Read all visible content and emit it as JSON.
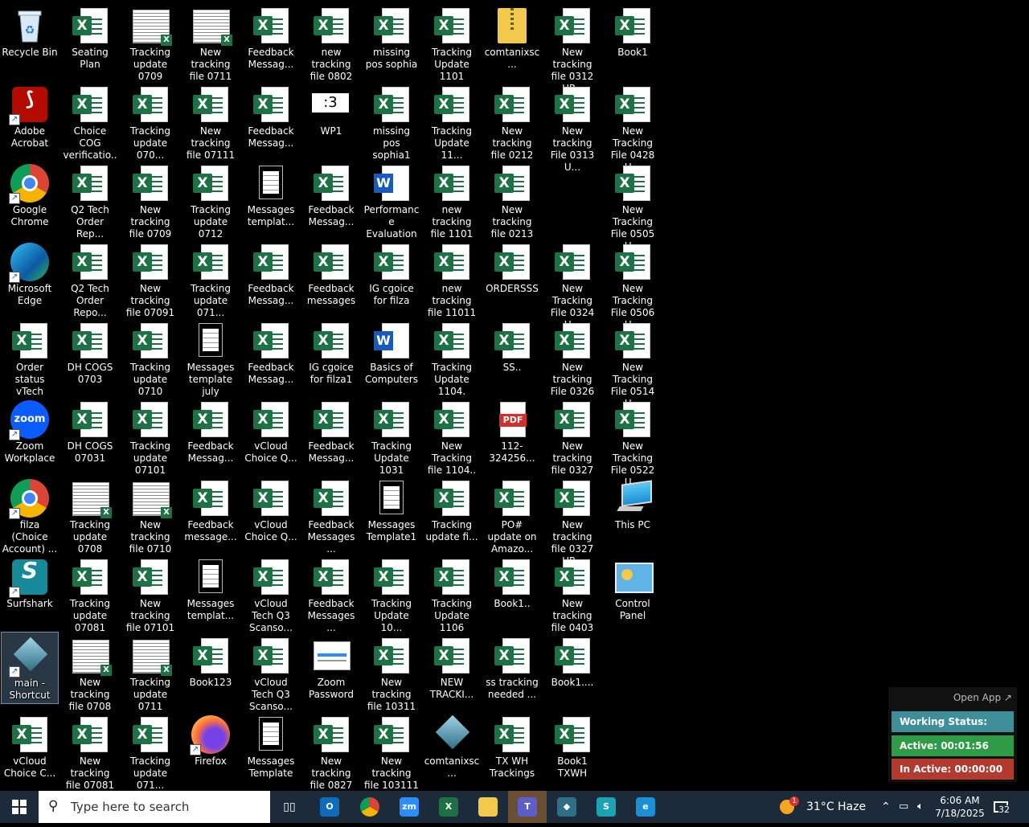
{
  "desktop_icons": [
    {
      "label": "Recycle Bin",
      "type": "recycle"
    },
    {
      "label": "Seating Plan",
      "type": "excel"
    },
    {
      "label": "Tracking update 0709",
      "type": "sheet"
    },
    {
      "label": "New tracking file 0711",
      "type": "sheet"
    },
    {
      "label": "Feedback Messag...",
      "type": "excel"
    },
    {
      "label": "new tracking file 0802",
      "type": "excel"
    },
    {
      "label": "missing pos sophia",
      "type": "excel"
    },
    {
      "label": "Tracking Update 1101",
      "type": "excel"
    },
    {
      "label": "comtanixsc...",
      "type": "zip"
    },
    {
      "label": "New tracking file 0312 UP...",
      "type": "excel"
    },
    {
      "label": "Book1",
      "type": "excel"
    },
    {
      "label": "Adobe Acrobat",
      "type": "acrobat",
      "shortcut": true
    },
    {
      "label": "Choice COG verificatio...",
      "type": "excel"
    },
    {
      "label": "Tracking update 070...",
      "type": "excel"
    },
    {
      "label": "New tracking file 07111",
      "type": "excel"
    },
    {
      "label": "Feedback Messag...",
      "type": "excel"
    },
    {
      "label": "WP1",
      "type": "wp",
      "glyph": ":3"
    },
    {
      "label": "missing pos sophia1",
      "type": "excel"
    },
    {
      "label": "Tracking Update 11...",
      "type": "excel"
    },
    {
      "label": "New tracking file 0212",
      "type": "excel"
    },
    {
      "label": "New tracking File 0313 U...",
      "type": "excel"
    },
    {
      "label": "New Tracking File 0428 U...",
      "type": "excel"
    },
    {
      "label": "Google Chrome",
      "type": "chrome",
      "shortcut": true
    },
    {
      "label": "Q2 Tech Order Rep...",
      "type": "excel"
    },
    {
      "label": "New tracking file 0709",
      "type": "excel"
    },
    {
      "label": "Tracking update 0712",
      "type": "excel"
    },
    {
      "label": "Messages templat...",
      "type": "doc"
    },
    {
      "label": "Feedback Messag...",
      "type": "excel"
    },
    {
      "label": "Performance Evaluation ...",
      "type": "word"
    },
    {
      "label": "new tracking file 1101",
      "type": "excel"
    },
    {
      "label": "New tracking file 0213",
      "type": "excel"
    },
    {
      "label": "New Tracking File 0505 U...",
      "type": "excel"
    },
    {
      "label": "Microsoft Edge",
      "type": "edge",
      "shortcut": true
    },
    {
      "label": "Q2 Tech Order Repo...",
      "type": "excel"
    },
    {
      "label": "New tracking file 07091",
      "type": "excel"
    },
    {
      "label": "Tracking update 071...",
      "type": "excel"
    },
    {
      "label": "Feedback Messag...",
      "type": "excel"
    },
    {
      "label": "Feedback messages",
      "type": "excel"
    },
    {
      "label": "IG cgoice for filza",
      "type": "excel"
    },
    {
      "label": "new tracking file 11011",
      "type": "excel"
    },
    {
      "label": "ORDERSSS",
      "type": "excel"
    },
    {
      "label": "New Tracking File 0324 U...",
      "type": "excel"
    },
    {
      "label": "New Tracking File 0506 U...",
      "type": "excel"
    },
    {
      "label": "Order status vTech",
      "type": "excel"
    },
    {
      "label": "DH COGS 0703",
      "type": "excel"
    },
    {
      "label": "Tracking update 0710",
      "type": "excel"
    },
    {
      "label": "Messages template july",
      "type": "doc"
    },
    {
      "label": "Feedback Messag...",
      "type": "excel"
    },
    {
      "label": "IG cgoice for filza1",
      "type": "excel"
    },
    {
      "label": "Basics of Computers",
      "type": "word"
    },
    {
      "label": "Tracking Update 1104.",
      "type": "excel"
    },
    {
      "label": "SS..",
      "type": "excel"
    },
    {
      "label": "New tracking File 0326",
      "type": "excel"
    },
    {
      "label": "New Tracking File 0514 U...",
      "type": "excel"
    },
    {
      "label": "Zoom Workplace",
      "type": "zoom",
      "shortcut": true,
      "glyph": "zoom"
    },
    {
      "label": "DH COGS 07031",
      "type": "excel"
    },
    {
      "label": "Tracking update 07101",
      "type": "excel"
    },
    {
      "label": "Feedback Messag...",
      "type": "excel"
    },
    {
      "label": "vCloud Choice Q...",
      "type": "excel"
    },
    {
      "label": "Feedback Messag...",
      "type": "excel"
    },
    {
      "label": "Tracking Update 1031",
      "type": "excel"
    },
    {
      "label": "New Tracking file 1104..",
      "type": "excel"
    },
    {
      "label": "112-324256...",
      "type": "pdf",
      "glyph": "PDF"
    },
    {
      "label": "New tracking file 0327",
      "type": "excel"
    },
    {
      "label": "New Tracking File 0522 U...",
      "type": "excel"
    },
    {
      "label": "filza (Choice Account) ...",
      "type": "chrome",
      "shortcut": true
    },
    {
      "label": "Tracking update 0708",
      "type": "sheet"
    },
    {
      "label": "New tracking file 0710",
      "type": "sheet"
    },
    {
      "label": "Feedback message...",
      "type": "excel"
    },
    {
      "label": "vCloud Choice Q...",
      "type": "excel"
    },
    {
      "label": "Feedback Messages ...",
      "type": "excel"
    },
    {
      "label": "Messages Template1",
      "type": "doc"
    },
    {
      "label": "Tracking update fi...",
      "type": "excel"
    },
    {
      "label": "PO# update on Amazo...",
      "type": "excel"
    },
    {
      "label": "New tracking file 0327 UP...",
      "type": "excel"
    },
    {
      "label": "This PC",
      "type": "pc"
    },
    {
      "label": "Surfshark",
      "type": "surfshark",
      "shortcut": true,
      "glyph": "S"
    },
    {
      "label": "Tracking update 07081",
      "type": "excel"
    },
    {
      "label": "New tracking file 07101",
      "type": "excel"
    },
    {
      "label": "Messages templat...",
      "type": "doc"
    },
    {
      "label": "vCloud Tech Q3 Scanso...",
      "type": "excel"
    },
    {
      "label": "Feedback Messages ...",
      "type": "excel"
    },
    {
      "label": "Tracking Update 10...",
      "type": "excel"
    },
    {
      "label": "Tracking Update 1106",
      "type": "excel"
    },
    {
      "label": "Book1..",
      "type": "excel"
    },
    {
      "label": "New tracking file 0403",
      "type": "excel"
    },
    {
      "label": "Control Panel",
      "type": "control"
    },
    {
      "label": "main - Shortcut",
      "type": "mainapp",
      "shortcut": true,
      "selected": true
    },
    {
      "label": "New tracking file 0708",
      "type": "sheet"
    },
    {
      "label": "Tracking update 0711",
      "type": "sheet"
    },
    {
      "label": "Book123",
      "type": "excel"
    },
    {
      "label": "vCloud Tech Q3 Scanso...",
      "type": "excel"
    },
    {
      "label": "Zoom Password",
      "type": "zoompass"
    },
    {
      "label": "New tracking file 10311",
      "type": "excel"
    },
    {
      "label": "NEW TRACKI...",
      "type": "excel"
    },
    {
      "label": "ss tracking needed ...",
      "type": "excel"
    },
    {
      "label": "Book1....",
      "type": "excel"
    },
    {
      "label": "vCloud Choice C...",
      "type": "excel"
    },
    {
      "label": "New tracking file 07081",
      "type": "excel"
    },
    {
      "label": "Tracking update 071...",
      "type": "excel"
    },
    {
      "label": "Firefox",
      "type": "firefox",
      "shortcut": true
    },
    {
      "label": "Messages Template",
      "type": "doc"
    },
    {
      "label": "New tracking file 0827",
      "type": "excel"
    },
    {
      "label": "New tracking file 103111",
      "type": "excel"
    },
    {
      "label": "comtanixsc...",
      "type": "mainapp"
    },
    {
      "label": "TX WH Trackings",
      "type": "excel"
    },
    {
      "label": "Book1 TXWH",
      "type": "excel"
    }
  ],
  "widget": {
    "open_app": "Open App ↗",
    "status": "Working Status: Active",
    "active": "Active: 00:01:56",
    "inactive": "In Active: 00:00:00",
    "colors": {
      "status": "#3f8f9a",
      "active": "#2e9b46",
      "inactive": "#b23a2e"
    }
  },
  "taskbar": {
    "search_placeholder": "Type here to search",
    "apps": [
      {
        "name": "task-view-button",
        "glyph": "▯▯"
      },
      {
        "name": "outlook-button",
        "glyph": "O",
        "color": "#0f6cbd"
      },
      {
        "name": "chrome-button",
        "glyph": "",
        "color": "chrome"
      },
      {
        "name": "zoom-button",
        "glyph": "zm",
        "color": "#2d8cff"
      },
      {
        "name": "excel-button",
        "glyph": "X",
        "color": "#1e7145"
      },
      {
        "name": "file-explorer-button",
        "glyph": "",
        "color": "#f2c94c"
      },
      {
        "name": "teams-button",
        "glyph": "T",
        "color": "#5b5fc7",
        "active": true
      },
      {
        "name": "main-app-button",
        "glyph": "◆",
        "color": "#2f6f86"
      },
      {
        "name": "surfshark-button",
        "glyph": "S",
        "color": "#1ba3b3"
      },
      {
        "name": "edge-button",
        "glyph": "e",
        "color": "#1a8fd6"
      }
    ],
    "weather": {
      "temp": "31°C",
      "condition": "Haze",
      "badge": "1"
    },
    "time": "6:06 AM",
    "date": "7/18/2025",
    "notifications": "32"
  }
}
